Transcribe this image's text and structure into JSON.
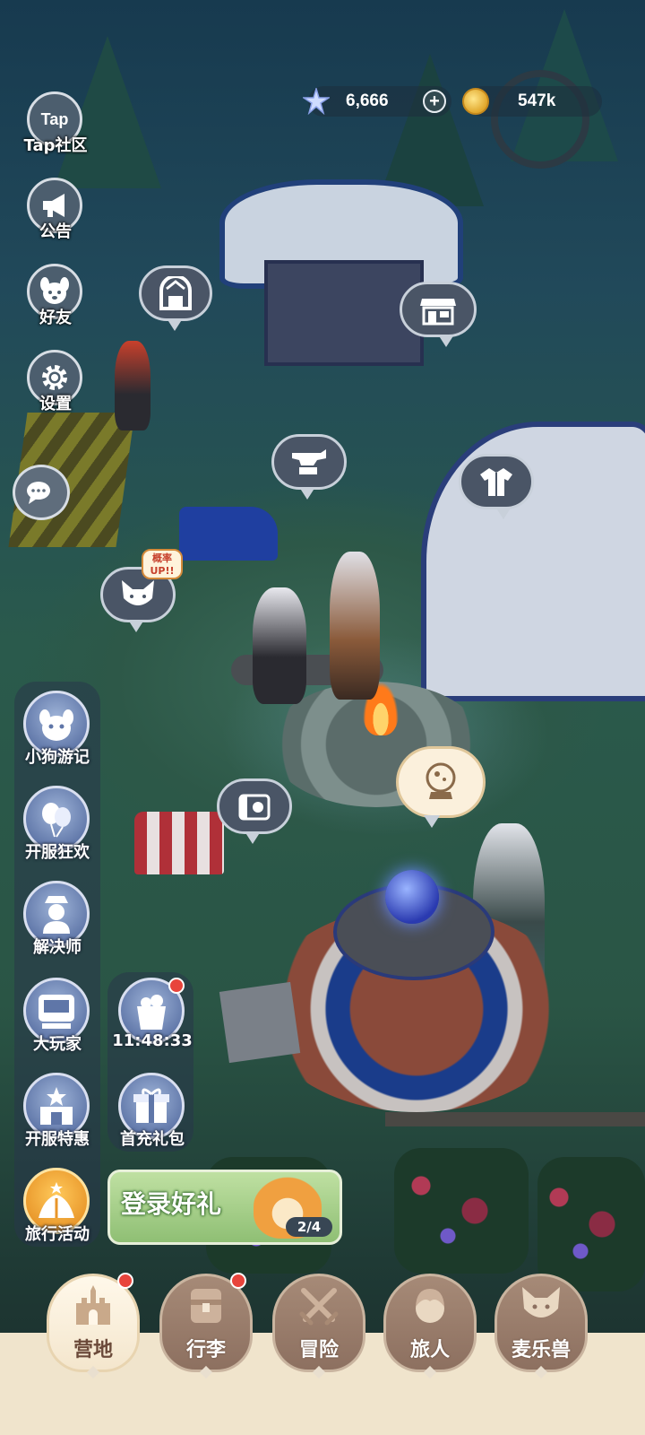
{
  "currency": {
    "gems": "6,666",
    "gems_plus": "+",
    "coins": "547k"
  },
  "side_menu": [
    {
      "label": "Tap社区",
      "icon": "tap-icon",
      "icon_text": "Tap"
    },
    {
      "label": "公告",
      "icon": "megaphone-icon"
    },
    {
      "label": "好友",
      "icon": "dog-face-icon"
    },
    {
      "label": "设置",
      "icon": "gear-icon"
    }
  ],
  "scene_badges": {
    "probability_up": "概率\nUP!!"
  },
  "events": [
    {
      "label": "小狗游记",
      "icon": "dog-travel-icon"
    },
    {
      "label": "开服狂欢",
      "icon": "balloons-icon"
    },
    {
      "label": "解决师",
      "icon": "solver-icon"
    },
    {
      "label": "大玩家",
      "icon": "arcade-machine-icon"
    },
    {
      "label": "11:48:33",
      "icon": "gift-bucket-icon",
      "notification": true
    },
    {
      "label": "开服特惠",
      "icon": "stars-shop-icon"
    },
    {
      "label": "首充礼包",
      "icon": "gift-box-icon"
    },
    {
      "label": "旅行活动",
      "icon": "tent-star-icon"
    }
  ],
  "login_reward": {
    "title": "登录好礼",
    "progress": "2/4"
  },
  "bottom_nav": [
    {
      "label": "营地",
      "icon": "castle-icon",
      "active": true,
      "notification": true
    },
    {
      "label": "行李",
      "icon": "backpack-icon",
      "active": false,
      "notification": true
    },
    {
      "label": "冒险",
      "icon": "crossed-swords-icon",
      "active": false,
      "notification": false
    },
    {
      "label": "旅人",
      "icon": "traveler-face-icon",
      "active": false,
      "notification": false
    },
    {
      "label": "麦乐兽",
      "icon": "fox-face-icon",
      "active": false,
      "notification": false
    }
  ],
  "colors": {
    "accent_red_dot": "#e8443c",
    "nav_active": "#f4e6cd",
    "nav_inactive": "#8d7060"
  }
}
